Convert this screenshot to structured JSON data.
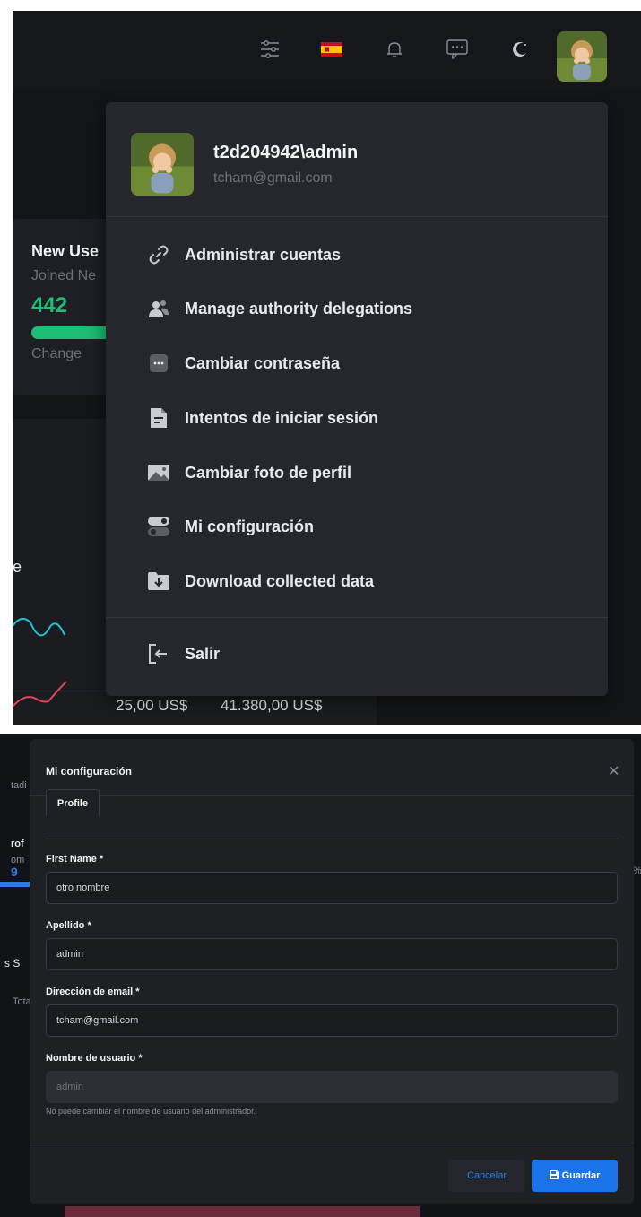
{
  "header": {
    "icons": [
      "sliders-icon",
      "spain-flag-icon",
      "bell-icon",
      "chat-icon",
      "moon-icon",
      "avatar"
    ]
  },
  "dashboard": {
    "new_users_title": "New Use",
    "new_users_subtitle": "Joined Ne",
    "new_users_value": "442",
    "new_users_change": "Change",
    "partial_label": "e",
    "amount_1": "25,00 US$",
    "amount_2": "41.380,00 US$",
    "accent_green": "#1cbf73"
  },
  "profile_menu": {
    "username": "t2d204942\\admin",
    "email": "tcham@gmail.com",
    "items": [
      {
        "label": "Administrar cuentas",
        "icon": "link-icon"
      },
      {
        "label": "Manage authority delegations",
        "icon": "users-icon"
      },
      {
        "label": "Cambiar contraseña",
        "icon": "password-icon"
      },
      {
        "label": "Intentos de iniciar sesión",
        "icon": "document-icon"
      },
      {
        "label": "Cambiar foto de perfil",
        "icon": "image-icon"
      },
      {
        "label": "Mi configuración",
        "icon": "toggle-icon"
      },
      {
        "label": "Download collected data",
        "icon": "download-folder-icon"
      }
    ],
    "logout_label": "Salir"
  },
  "settings_modal": {
    "title": "Mi configuración",
    "tab_profile": "Profile",
    "first_name_label": "First Name",
    "first_name_value": "otro nombre",
    "surname_label": "Apellido",
    "surname_value": "admin",
    "email_label": "Dirección de email",
    "email_value": "tcham@gmail.com",
    "username_label": "Nombre de usuario",
    "username_value": "admin",
    "username_help": "No puede cambiar el nombre de usuario del administrador.",
    "required_mark": "*",
    "cancel_label": "Cancelar",
    "save_label": "Guardar",
    "primary_color": "#1a73e8"
  },
  "background_fragments": {
    "frag_1": "tadi",
    "frag_2": "rof",
    "frag_3": "om",
    "frag_4": "9",
    "frag_5": "s S",
    "frag_6": "Tota",
    "frag_7": "%"
  }
}
